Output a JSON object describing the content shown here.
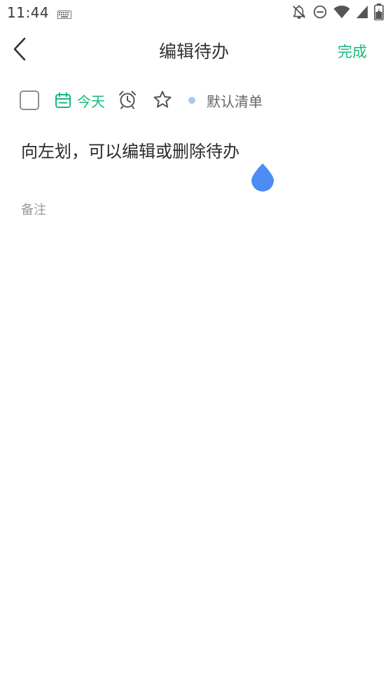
{
  "status_bar": {
    "time": "11:44",
    "icons": [
      "keyboard-icon",
      "notifications-off-icon",
      "do-not-disturb-icon",
      "wifi-icon",
      "signal-icon",
      "battery-icon"
    ]
  },
  "header": {
    "title": "编辑待办",
    "done_label": "完成"
  },
  "toolbar": {
    "checkbox_checked": false,
    "date_label": "今天",
    "list_label": "默认清单",
    "list_color": "#a9c8f0"
  },
  "todo": {
    "title": "向左划，可以编辑或删除待办",
    "notes_placeholder": "备注"
  },
  "colors": {
    "accent": "#17b978",
    "cursor_handle": "#4c8cf5"
  }
}
